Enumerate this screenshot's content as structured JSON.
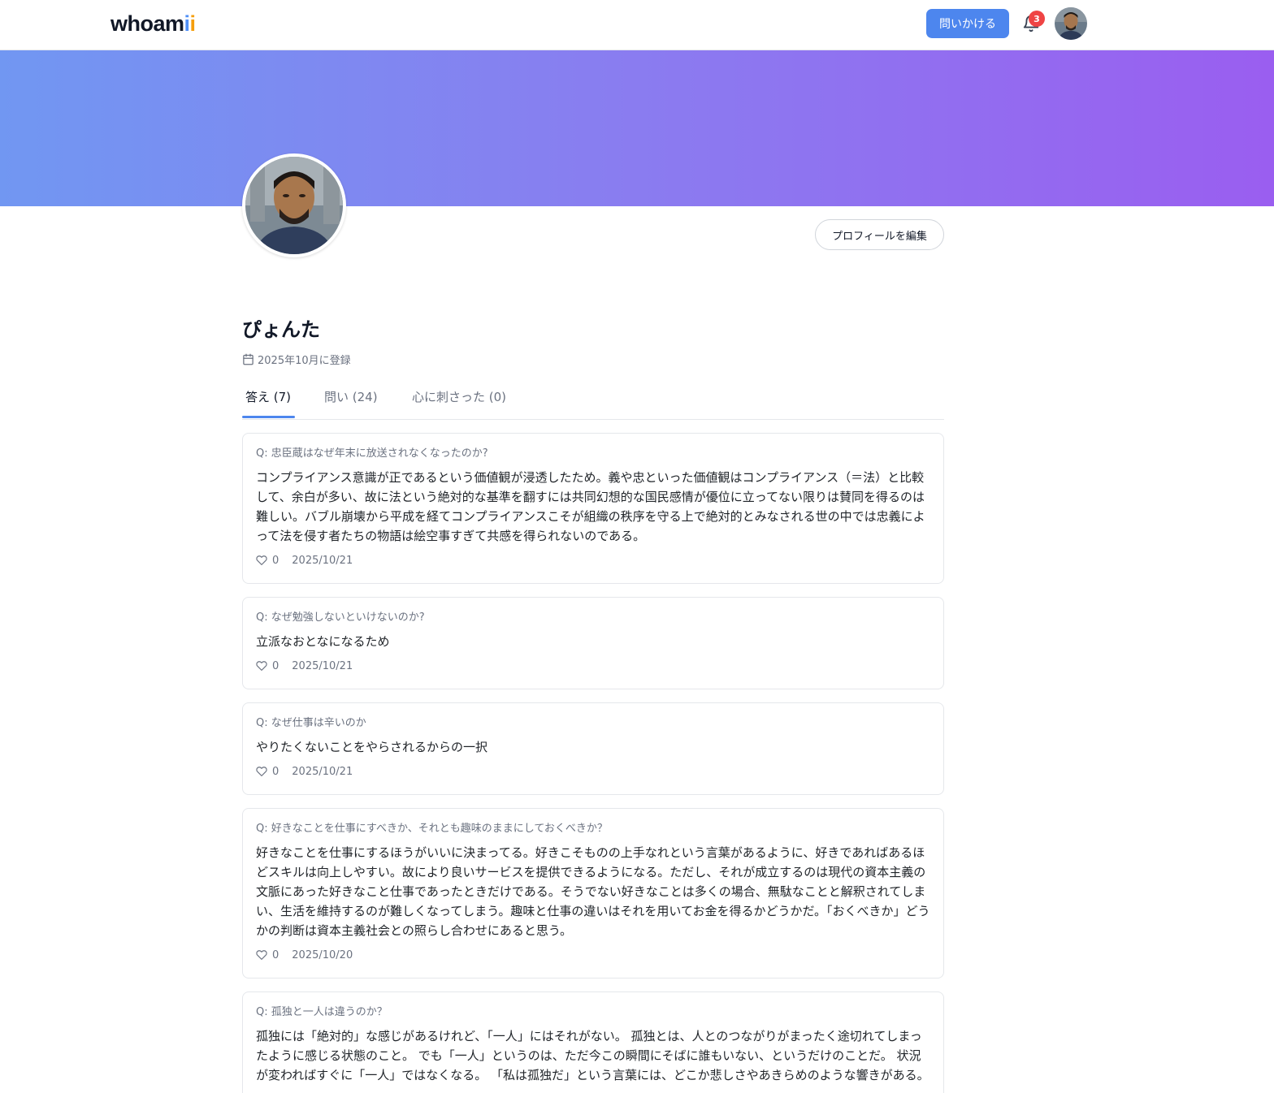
{
  "header": {
    "logo_prefix": "whoam",
    "logo_i1": "i",
    "logo_i2": "i",
    "ask_label": "問いかける",
    "notification_count": "3"
  },
  "profile": {
    "edit_label": "プロフィールを編集",
    "name": "ぴょんた",
    "joined": "2025年10月に登録"
  },
  "tabs": [
    {
      "label": "答え (7)"
    },
    {
      "label": "問い (24)"
    },
    {
      "label": "心に刺さった (0)"
    }
  ],
  "answers": [
    {
      "question": "Q: 忠臣蔵はなぜ年末に放送されなくなったのか?",
      "answer": "コンプライアンス意識が正であるという価値観が浸透したため。義や忠といった価値観はコンプライアンス（＝法）と比較して、余白が多い、故に法という絶対的な基準を翻すには共同幻想的な国民感情が優位に立ってない限りは賛同を得るのは難しい。バブル崩壊から平成を経てコンプライアンスこそが組織の秩序を守る上で絶対的とみなされる世の中では忠義によって法を侵す者たちの物語は絵空事すぎて共感を得られないのである。",
      "likes": "0",
      "date": "2025/10/21"
    },
    {
      "question": "Q: なぜ勉強しないといけないのか?",
      "answer": "立派なおとなになるため",
      "likes": "0",
      "date": "2025/10/21"
    },
    {
      "question": "Q: なぜ仕事は辛いのか",
      "answer": "やりたくないことをやらされるからの一択",
      "likes": "0",
      "date": "2025/10/21"
    },
    {
      "question": "Q: 好きなことを仕事にすべきか、それとも趣味のままにしておくべきか？",
      "answer": "好きなことを仕事にするほうがいいに決まってる。好きこそものの上手なれという言葉があるように、好きであればあるほどスキルは向上しやすい。故により良いサービスを提供できるようになる。ただし、それが成立するのは現代の資本主義の文脈にあった好きなこと仕事であったときだけである。そうでない好きなことは多くの場合、無駄なことと解釈されてしまい、生活を維持するのが難しくなってしまう。趣味と仕事の違いはそれを用いてお金を得るかどうかだ。「おくべきか」どうかの判断は資本主義社会との照らし合わせにあると思う。",
      "likes": "0",
      "date": "2025/10/20"
    },
    {
      "question": "Q: 孤独と一人は違うのか？",
      "answer": "孤独には「絶対的」な感じがあるけれど、「一人」にはそれがない。 孤独とは、人とのつながりがまったく途切れてしまったように感じる状態のこと。 でも「一人」というのは、ただ今この瞬間にそばに誰もいない、というだけのことだ。 状況が変わればすぐに「一人」ではなくなる。 「私は孤独だ」という言葉には、どこか悲しさやあきらめのような響きがある。",
      "likes": "",
      "date": ""
    }
  ]
}
